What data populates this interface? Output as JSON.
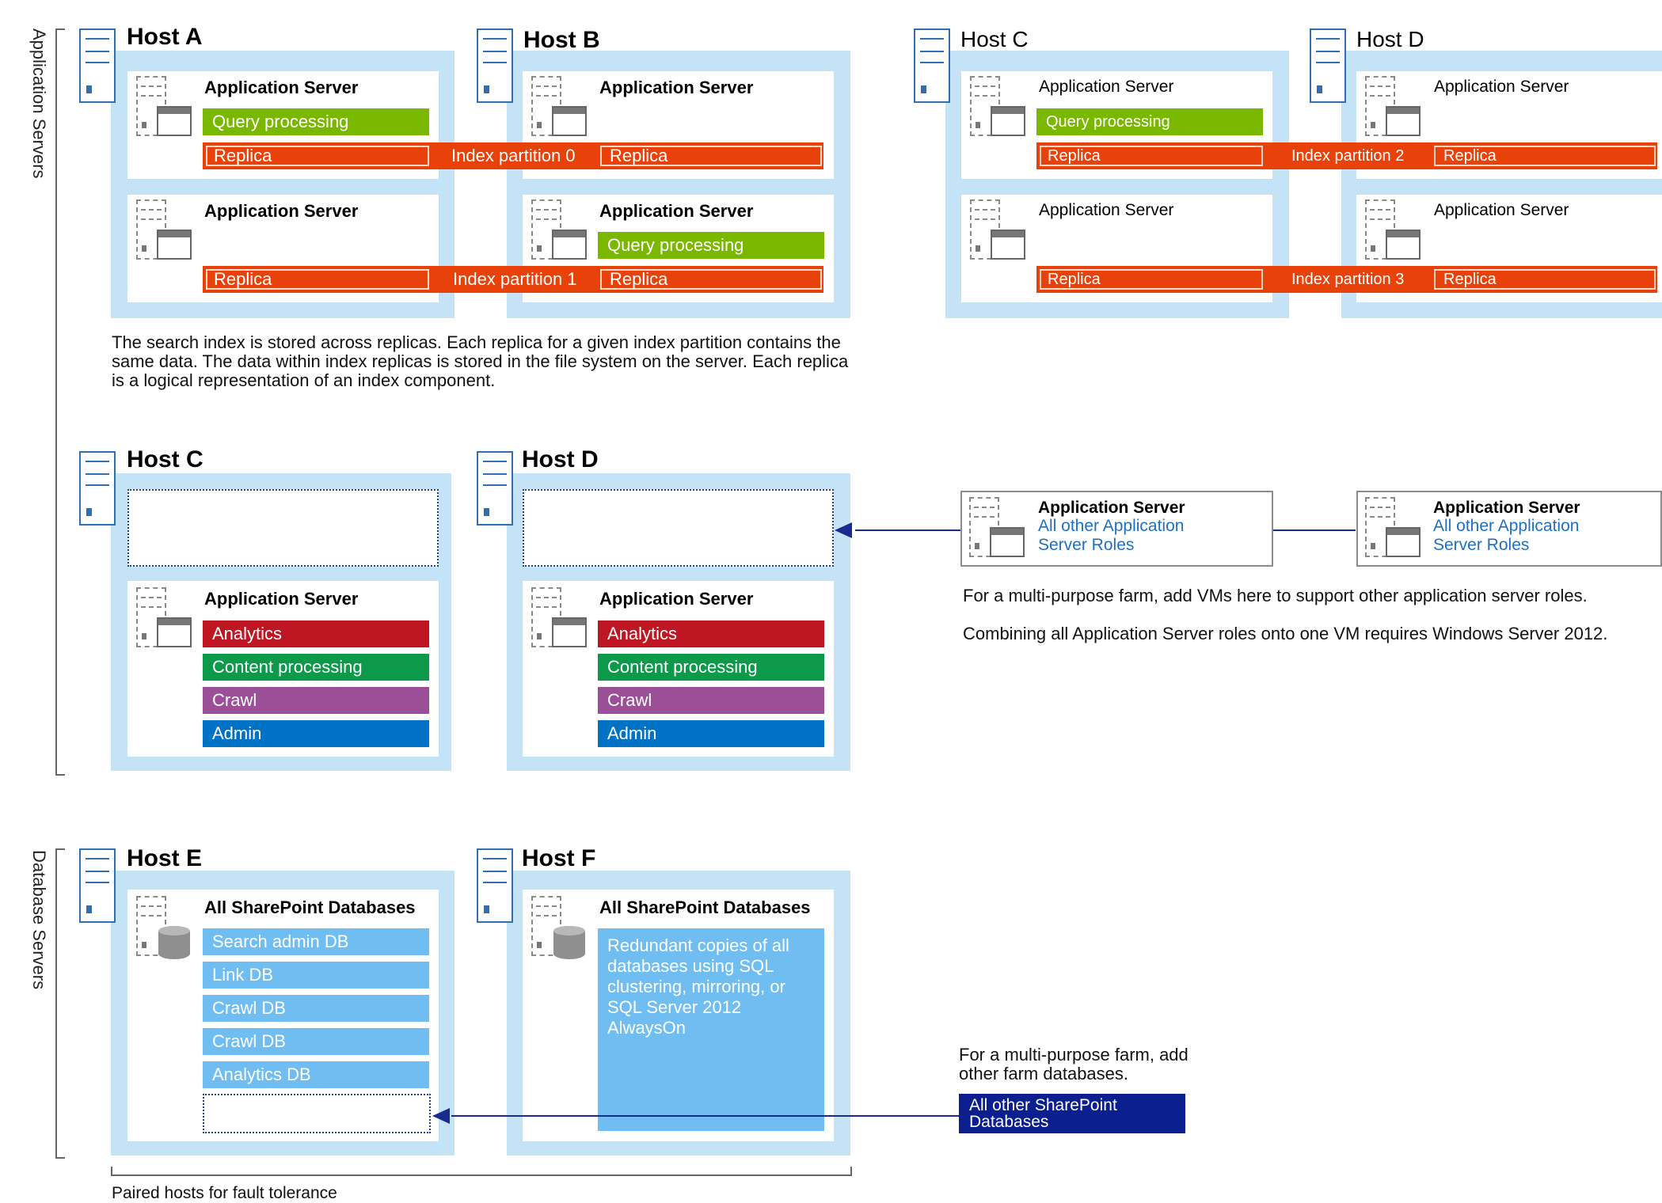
{
  "side_labels": {
    "application_servers": "Application Servers",
    "database_servers": "Database Servers"
  },
  "hosts": {
    "a": "Host A",
    "b": "Host B",
    "c_top": "Host C",
    "d_top": "Host D",
    "c_mid": "Host C",
    "d_mid": "Host D",
    "e": "Host E",
    "f": "Host F"
  },
  "server_title": "Application Server",
  "db_title": "All SharePoint Databases",
  "roles": {
    "query": "Query processing",
    "analytics": "Analytics",
    "content": "Content processing",
    "crawl": "Crawl",
    "admin": "Admin"
  },
  "replica": "Replica",
  "partitions": [
    "Index partition 0",
    "Index partition 1",
    "Index partition 2",
    "Index partition 3"
  ],
  "captions": {
    "index_note": "The search index is stored across replicas. Each replica for a given index partition contains the same data. The data within index replicas is stored in the file system on the server. Each replica is a logical representation of an index component.",
    "multi_purpose_app": "For a multi-purpose farm, add VMs here to support other application server roles.",
    "combining_roles": "Combining all Application Server roles onto one VM requires Windows Server 2012.",
    "multi_purpose_db": "For a multi-purpose farm, add other farm databases.",
    "paired_hosts": "Paired hosts for fault tolerance"
  },
  "other_app": {
    "title": "Application Server",
    "subtitle": "All other Application Server Roles"
  },
  "databases": [
    "Search admin DB",
    "Link DB",
    "Crawl DB",
    "Crawl DB",
    "Analytics DB"
  ],
  "redundant_note": "Redundant copies of all databases using SQL clustering, mirroring, or SQL Server 2012 AlwaysOn",
  "other_db": "All other SharePoint Databases",
  "colors": {
    "host_bg": "#c5e3f7",
    "query": "#7ab800",
    "replica": "#e8410a",
    "analytics": "#be1622",
    "content": "#0c9a4a",
    "crawl": "#9b4f96",
    "admin": "#0072c6",
    "db_item": "#70bdf2",
    "other_db": "#0b1f8f",
    "arrow": "#1a2a8f"
  },
  "icons": [
    "host-server-icon",
    "application-server-icon",
    "database-server-icon",
    "arrow-left-icon"
  ]
}
